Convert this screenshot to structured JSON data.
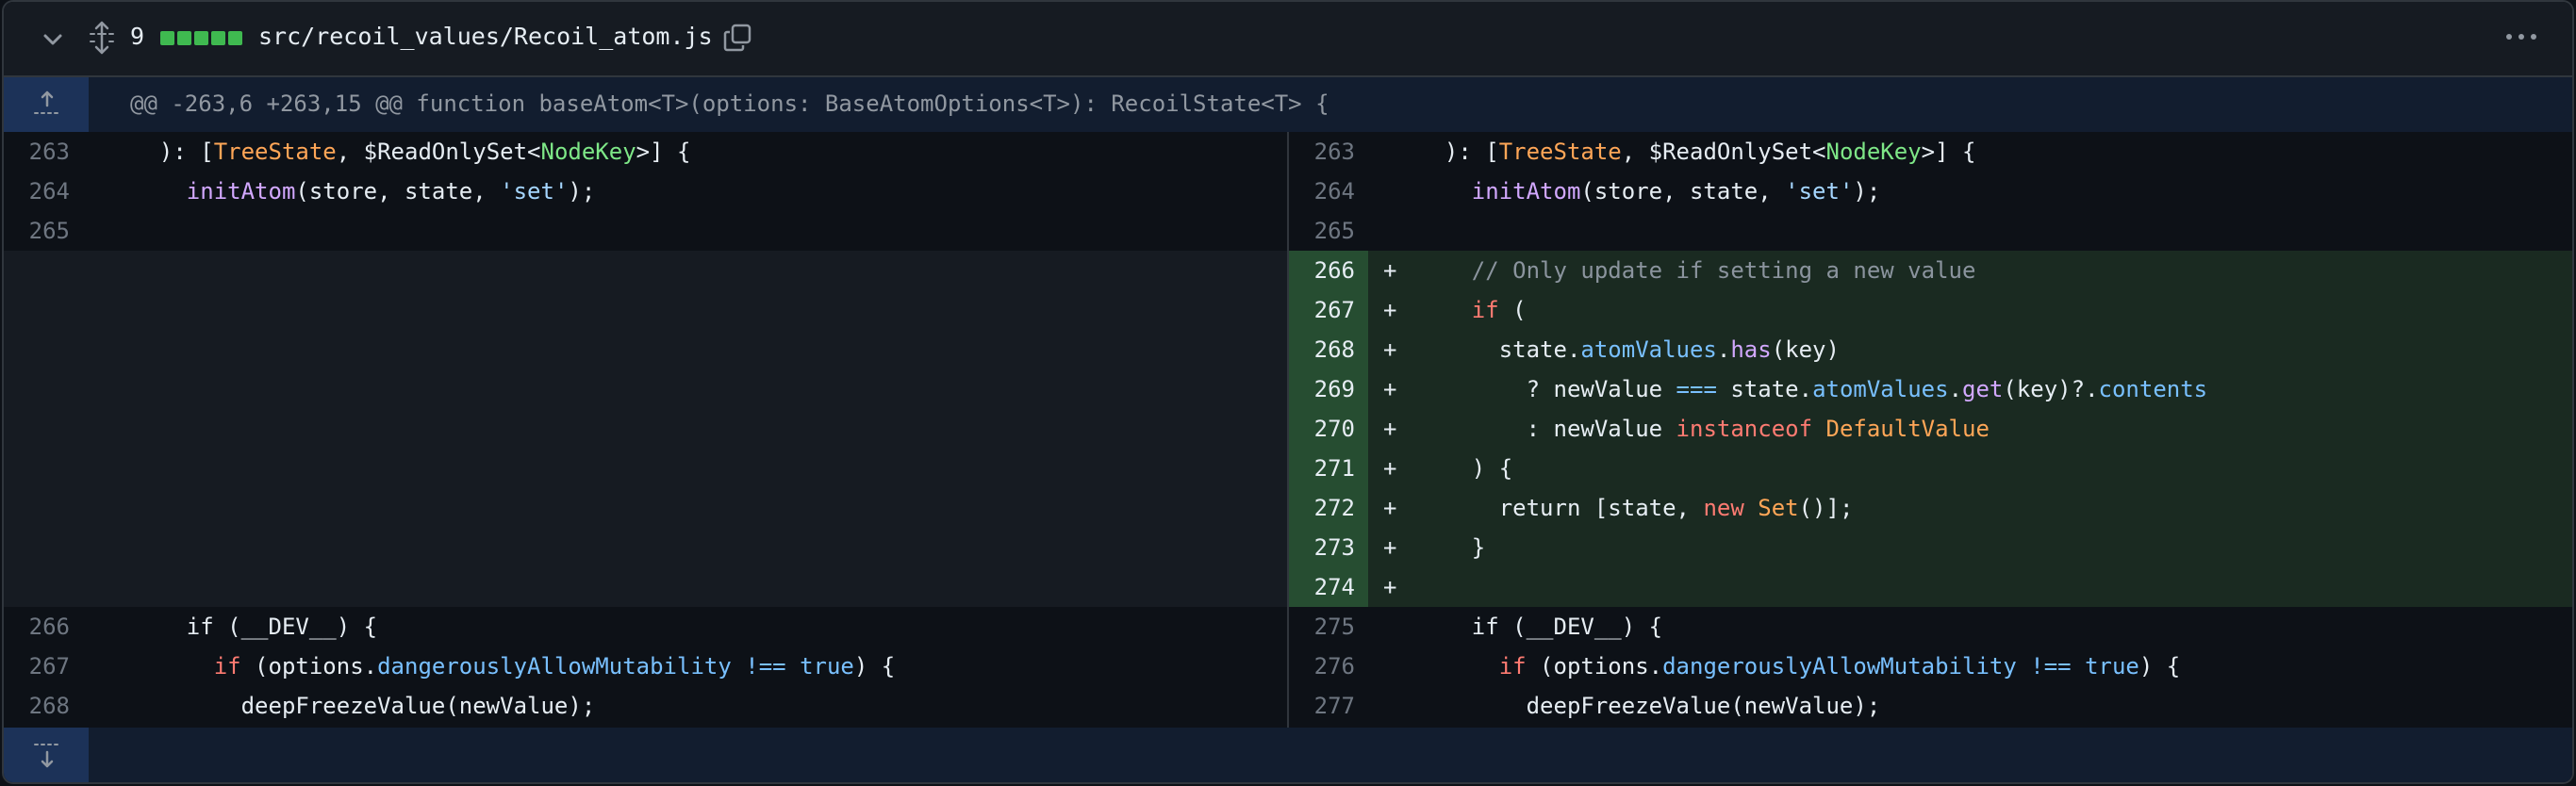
{
  "file": {
    "changes_count": "9",
    "path": "src/recoil_values/Recoil_atom.js",
    "diffstat_additions": 5,
    "icons": [
      "chevron-down-icon",
      "unfold-icon",
      "copy-icon",
      "kebab-horizontal-icon",
      "fold-up-icon",
      "fold-down-icon"
    ]
  },
  "hunk_header": "@@ -263,6 +263,15 @@ function baseAtom<T>(options: BaseAtomOptions<T>): RecoilState<T> {",
  "colors": {
    "addition_bg": "#1a2a21",
    "addition_gutter": "#264d31",
    "hunk_bg": "#121d2f",
    "diffstat_green": "#3fb950"
  },
  "left_lines": [
    {
      "num": "263",
      "text": "  ): [TreeState, $ReadOnlySet<NodeKey>] {"
    },
    {
      "num": "264",
      "text": "    initAtom(store, state, 'set');"
    },
    {
      "num": "265",
      "text": ""
    },
    {
      "num": "266",
      "text": "    if (__DEV__) {"
    },
    {
      "num": "267",
      "text": "      if (options.dangerouslyAllowMutability !== true) {"
    },
    {
      "num": "268",
      "text": "        deepFreezeValue(newValue);"
    }
  ],
  "right_lines": [
    {
      "num": "263",
      "marker": "",
      "text": "  ): [TreeState, $ReadOnlySet<NodeKey>] {"
    },
    {
      "num": "264",
      "marker": "",
      "text": "    initAtom(store, state, 'set');"
    },
    {
      "num": "265",
      "marker": "",
      "text": ""
    },
    {
      "num": "266",
      "marker": "+",
      "text": "    // Only update if setting a new value"
    },
    {
      "num": "267",
      "marker": "+",
      "text": "    if ("
    },
    {
      "num": "268",
      "marker": "+",
      "text": "      state.atomValues.has(key)"
    },
    {
      "num": "269",
      "marker": "+",
      "text": "        ? newValue === state.atomValues.get(key)?.contents"
    },
    {
      "num": "270",
      "marker": "+",
      "text": "        : newValue instanceof DefaultValue"
    },
    {
      "num": "271",
      "marker": "+",
      "text": "    ) {"
    },
    {
      "num": "272",
      "marker": "+",
      "text": "      return [state, new Set()];"
    },
    {
      "num": "273",
      "marker": "+",
      "text": "    }"
    },
    {
      "num": "274",
      "marker": "+",
      "text": ""
    },
    {
      "num": "275",
      "marker": "",
      "text": "    if (__DEV__) {"
    },
    {
      "num": "276",
      "marker": "",
      "text": "      if (options.dangerouslyAllowMutability !== true) {"
    },
    {
      "num": "277",
      "marker": "",
      "text": "        deepFreezeValue(newValue);"
    }
  ]
}
